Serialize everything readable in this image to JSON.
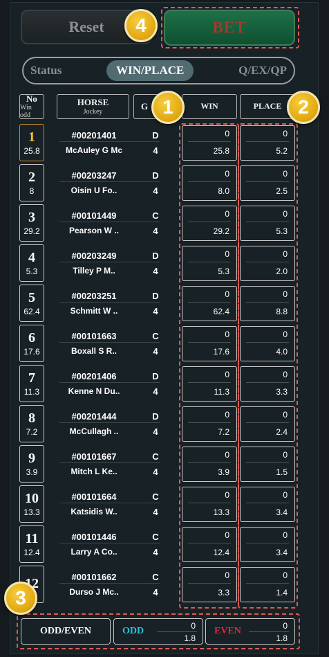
{
  "buttons": {
    "reset": "Reset",
    "bet": "BET"
  },
  "tabs": [
    {
      "label": "Status",
      "active": false
    },
    {
      "label": "WIN/PLACE",
      "active": true
    },
    {
      "label": "Q/EX/QP",
      "active": false
    }
  ],
  "header": {
    "no": "No",
    "win_odd": "Win odd",
    "horse": "HORSE",
    "jockey": "Jockey",
    "g": "G",
    "win": "WIN",
    "place": "PLACE"
  },
  "badges": [
    "1",
    "2",
    "3",
    "4"
  ],
  "runners": [
    {
      "no": "1",
      "win_odd": "25.8",
      "horse": "#00201401",
      "jockey": "McAuley G Mc",
      "grade": "D",
      "gnum": "4",
      "win_bet": "0",
      "win_odds": "25.8",
      "place_bet": "0",
      "place_odds": "5.2"
    },
    {
      "no": "2",
      "win_odd": "8",
      "horse": "#00203247",
      "jockey": "Oisin U Fo..",
      "grade": "D",
      "gnum": "4",
      "win_bet": "0",
      "win_odds": "8.0",
      "place_bet": "0",
      "place_odds": "2.5"
    },
    {
      "no": "3",
      "win_odd": "29.2",
      "horse": "#00101449",
      "jockey": "Pearson W ..",
      "grade": "C",
      "gnum": "4",
      "win_bet": "0",
      "win_odds": "29.2",
      "place_bet": "0",
      "place_odds": "5.3"
    },
    {
      "no": "4",
      "win_odd": "5.3",
      "horse": "#00203249",
      "jockey": "Tilley P M..",
      "grade": "D",
      "gnum": "4",
      "win_bet": "0",
      "win_odds": "5.3",
      "place_bet": "0",
      "place_odds": "2.0"
    },
    {
      "no": "5",
      "win_odd": "62.4",
      "horse": "#00203251",
      "jockey": "Schmitt W ..",
      "grade": "D",
      "gnum": "4",
      "win_bet": "0",
      "win_odds": "62.4",
      "place_bet": "0",
      "place_odds": "8.8"
    },
    {
      "no": "6",
      "win_odd": "17.6",
      "horse": "#00101663",
      "jockey": "Boxall S R..",
      "grade": "C",
      "gnum": "4",
      "win_bet": "0",
      "win_odds": "17.6",
      "place_bet": "0",
      "place_odds": "4.0"
    },
    {
      "no": "7",
      "win_odd": "11.3",
      "horse": "#00201406",
      "jockey": "Kenne N Du..",
      "grade": "D",
      "gnum": "4",
      "win_bet": "0",
      "win_odds": "11.3",
      "place_bet": "0",
      "place_odds": "3.3"
    },
    {
      "no": "8",
      "win_odd": "7.2",
      "horse": "#00201444",
      "jockey": "McCullagh ..",
      "grade": "D",
      "gnum": "4",
      "win_bet": "0",
      "win_odds": "7.2",
      "place_bet": "0",
      "place_odds": "2.4"
    },
    {
      "no": "9",
      "win_odd": "3.9",
      "horse": "#00101667",
      "jockey": "Mitch L Ke..",
      "grade": "C",
      "gnum": "4",
      "win_bet": "0",
      "win_odds": "3.9",
      "place_bet": "0",
      "place_odds": "1.5"
    },
    {
      "no": "10",
      "win_odd": "13.3",
      "horse": "#00101664",
      "jockey": "Katsidis W..",
      "grade": "C",
      "gnum": "4",
      "win_bet": "0",
      "win_odds": "13.3",
      "place_bet": "0",
      "place_odds": "3.4"
    },
    {
      "no": "11",
      "win_odd": "12.4",
      "horse": "#00101446",
      "jockey": "Larry A Co..",
      "grade": "C",
      "gnum": "4",
      "win_bet": "0",
      "win_odds": "12.4",
      "place_bet": "0",
      "place_odds": "3.4"
    },
    {
      "no": "12",
      "win_odd": "",
      "horse": "#00101662",
      "jockey": "Durso J Mc..",
      "grade": "C",
      "gnum": "4",
      "win_bet": "0",
      "win_odds": "3.3",
      "place_bet": "0",
      "place_odds": "1.4"
    }
  ],
  "odd_even": {
    "label": "ODD/EVEN",
    "odd_label": "ODD",
    "odd_bet": "0",
    "odd_odds": "1.8",
    "even_label": "EVEN",
    "even_bet": "0",
    "even_odds": "1.8"
  },
  "colors": {
    "gold": "#f2c230",
    "odd": "#29c4d9",
    "even": "#e0263b",
    "dashed": "#e25a4f",
    "bet_green": "#1d7048"
  }
}
